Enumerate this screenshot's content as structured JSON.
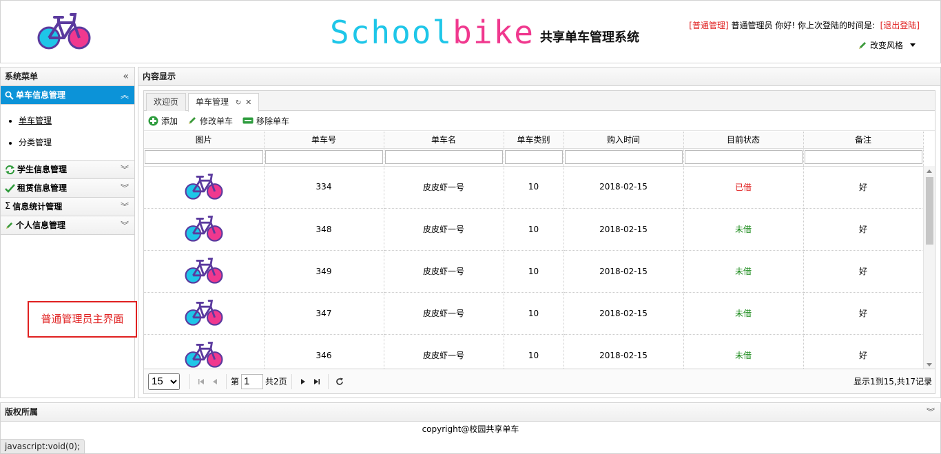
{
  "header": {
    "brand_school": "School",
    "brand_bike": "bike",
    "brand_subtitle": "共享单车管理系统",
    "role_badge": "[普通管理]",
    "greeting": "普通管理员 你好! 你上次登陆的时间是:",
    "logout": "[退出登陆]",
    "style_switch": "改变风格"
  },
  "sidebar": {
    "title": "系统菜单",
    "sections": [
      {
        "label": "单车信息管理",
        "items": [
          "单车管理",
          "分类管理"
        ]
      },
      {
        "label": "学生信息管理"
      },
      {
        "label": "租赁信息管理"
      },
      {
        "label": "信息统计管理"
      },
      {
        "label": "个人信息管理"
      }
    ]
  },
  "note": "普通管理员主界面",
  "content": {
    "title": "内容显示",
    "tabs": [
      {
        "label": "欢迎页"
      },
      {
        "label": "单车管理"
      }
    ],
    "toolbar": {
      "add": "添加",
      "edit": "修改单车",
      "remove": "移除单车"
    },
    "columns": [
      "图片",
      "单车号",
      "单车名",
      "单车类别",
      "购入时间",
      "目前状态",
      "备注"
    ],
    "rows": [
      {
        "id": "334",
        "name": "皮皮虾一号",
        "category": "10",
        "date": "2018-02-15",
        "status": "已借",
        "status_code": "out",
        "remark": "好"
      },
      {
        "id": "348",
        "name": "皮皮虾一号",
        "category": "10",
        "date": "2018-02-15",
        "status": "未借",
        "status_code": "in",
        "remark": "好"
      },
      {
        "id": "349",
        "name": "皮皮虾一号",
        "category": "10",
        "date": "2018-02-15",
        "status": "未借",
        "status_code": "in",
        "remark": "好"
      },
      {
        "id": "347",
        "name": "皮皮虾一号",
        "category": "10",
        "date": "2018-02-15",
        "status": "未借",
        "status_code": "in",
        "remark": "好"
      },
      {
        "id": "346",
        "name": "皮皮虾一号",
        "category": "10",
        "date": "2018-02-15",
        "status": "未借",
        "status_code": "in",
        "remark": "好"
      }
    ],
    "pager": {
      "page_size": "15",
      "page_prefix": "第",
      "page_value": "1",
      "page_total": "共2页",
      "info": "显示1到15,共17记录"
    }
  },
  "footer": {
    "title": "版权所属",
    "copyright": "copyright@校园共享单车"
  },
  "statusbar": "javascript:void(0);",
  "colors": {
    "accent": "#0c93d8",
    "danger": "#e02020",
    "success": "#1a8a1a",
    "bike_blue": "#1ec6e8",
    "bike_pink": "#f0388e",
    "bike_frame": "#6a3fa0"
  }
}
